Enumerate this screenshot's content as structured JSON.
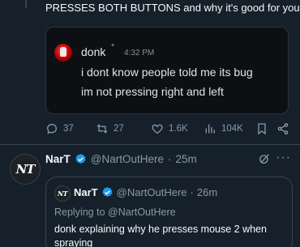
{
  "tweet": {
    "text_line1": "PRESSES BOTH BUTTONS and why it's good for you.",
    "media": {
      "username": "donk",
      "badge": "*",
      "time": "4:32 PM",
      "line1": "i dont know people told me its bug",
      "line2": "im not pressing right and left"
    },
    "actions": {
      "replies": "37",
      "retweets": "27",
      "likes": "1.6K",
      "views": "104K"
    }
  },
  "reply": {
    "avatar_text": "NT",
    "name": "NarT",
    "handle": "@NartOutHere",
    "separator": "·",
    "age": "25m",
    "quote": {
      "avatar_text": "NT",
      "name": "NarT",
      "handle": "@NartOutHere",
      "separator": "·",
      "age": "26m",
      "replying_prefix": "Replying to",
      "replying_handle": "@NartOutHere",
      "text_line1": "donk explaining why he presses mouse 2 when",
      "text_line2": "spraying"
    }
  },
  "colors": {
    "background": "#15202b",
    "accent": "#1d9bf0",
    "muted": "#8b98a5"
  }
}
